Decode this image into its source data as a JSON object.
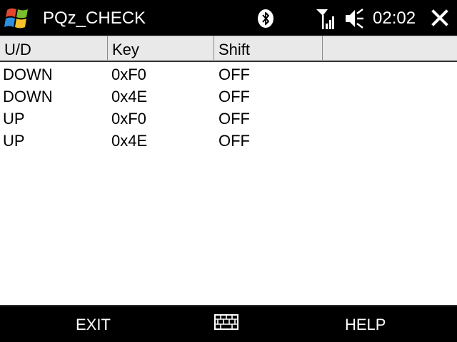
{
  "statusbar": {
    "app_title": "PQz_CHECK",
    "clock": "02:02",
    "icons": [
      "windows-start-icon",
      "bluetooth-icon",
      "signal-icon",
      "volume-muted-icon",
      "close-icon"
    ]
  },
  "table": {
    "columns": [
      "U/D",
      "Key",
      "Shift"
    ],
    "rows": [
      [
        "DOWN",
        "0xF0",
        "OFF"
      ],
      [
        "DOWN",
        "0x4E",
        "OFF"
      ],
      [
        "UP",
        "0xF0",
        "OFF"
      ],
      [
        "UP",
        "0x4E",
        "OFF"
      ]
    ]
  },
  "softkeys": {
    "left": "EXIT",
    "center_icon": "keyboard-icon",
    "right": "HELP"
  },
  "colors": {
    "bar_background": "#000000",
    "header_background": "#e9e9e9",
    "list_background": "#ffffff"
  }
}
